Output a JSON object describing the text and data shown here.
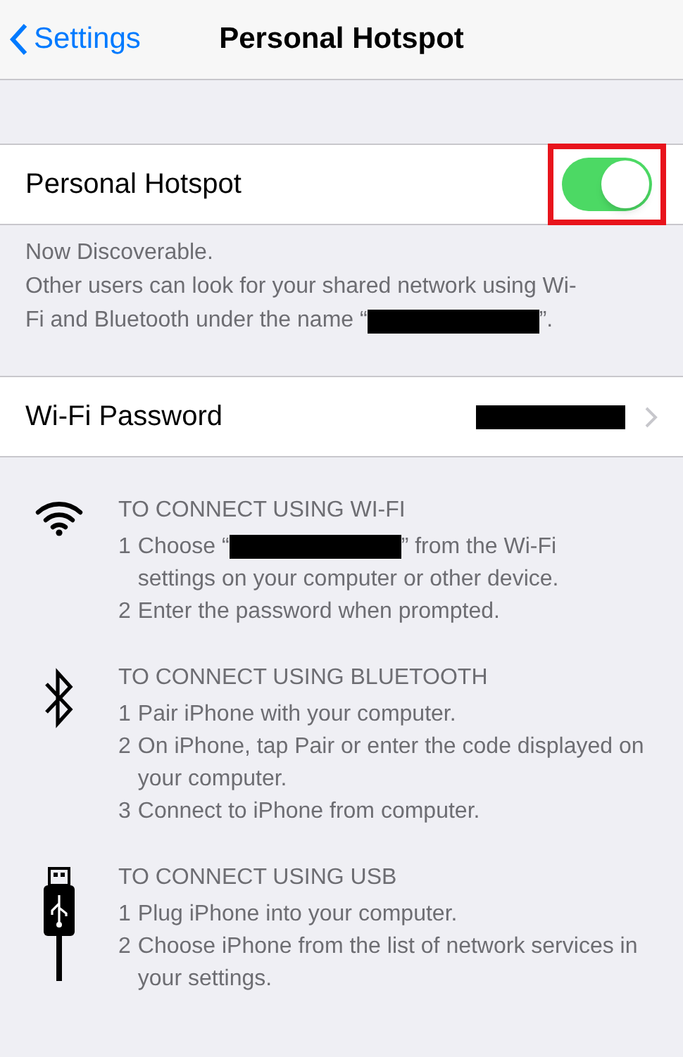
{
  "nav": {
    "back_label": "Settings",
    "title": "Personal Hotspot"
  },
  "hotspot": {
    "label": "Personal Hotspot",
    "on": true,
    "highlighted": true
  },
  "footer": {
    "status": "Now Discoverable.",
    "text_line": "Other users can look for your shared network using Wi-",
    "text_before": "Fi and Bluetooth under the name “",
    "redacted": true,
    "text_after": "”."
  },
  "wifi_password": {
    "label": "Wi-Fi Password",
    "redacted": true
  },
  "instructions": [
    {
      "kind": "wifi",
      "heading": "TO CONNECT USING WI-FI",
      "steps": [
        {
          "number": "1",
          "text": "Choose “",
          "redacted": true,
          "text_after": "” from the Wi-Fi",
          "text_next_line": "settings on your computer or other device."
        },
        {
          "number": "2",
          "text": "Enter the password when prompted."
        }
      ]
    },
    {
      "kind": "bluetooth",
      "heading": "TO CONNECT USING BLUETOOTH",
      "steps": [
        {
          "number": "1",
          "text": "Pair iPhone with your computer."
        },
        {
          "number": "2",
          "text": "On iPhone, tap Pair or enter the code displayed on your computer."
        },
        {
          "number": "3",
          "text": "Connect to iPhone from computer."
        }
      ]
    },
    {
      "kind": "usb",
      "heading": "TO CONNECT USING USB",
      "steps": [
        {
          "number": "1",
          "text": "Plug iPhone into your computer."
        },
        {
          "number": "2",
          "text": "Choose iPhone from the list of network services in your settings."
        }
      ]
    }
  ]
}
